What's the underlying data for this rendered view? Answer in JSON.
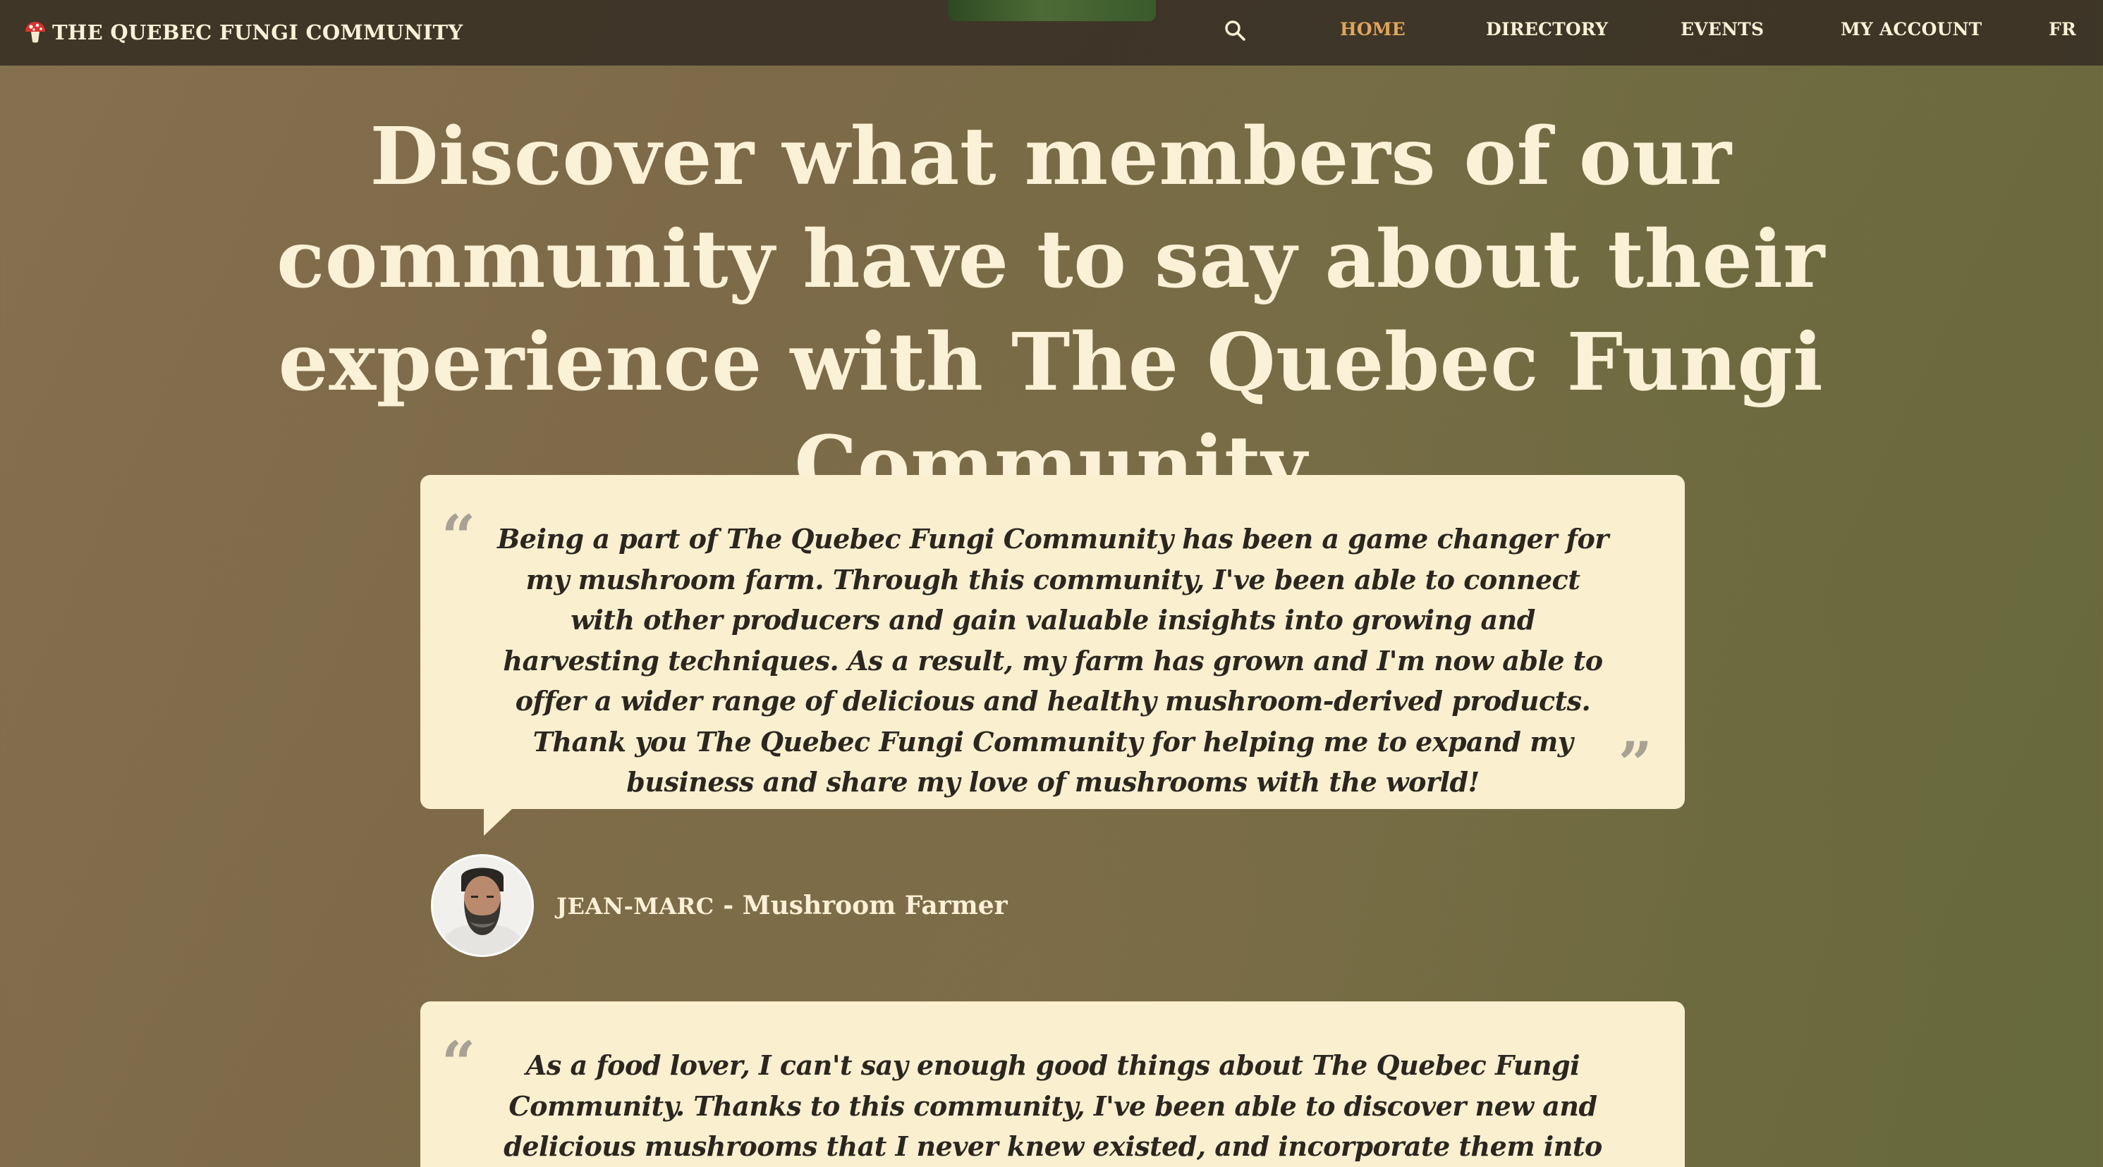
{
  "navbar": {
    "brand_label": "THE QUEBEC FUNGI COMMUNITY",
    "brand_icon": "mushroom-icon",
    "search_icon": "search-icon",
    "links": [
      {
        "label": "HOME",
        "active": true
      },
      {
        "label": "DIRECTORY",
        "active": false
      },
      {
        "label": "EVENTS",
        "active": false
      },
      {
        "label": "MY ACCOUNT",
        "active": false
      },
      {
        "label": "FR",
        "active": false
      }
    ]
  },
  "page": {
    "headline": "Discover what members of our community have to say about their experience with The Quebec Fungi Community"
  },
  "testimonials": [
    {
      "quote": "Being a part of The Quebec Fungi Community has been a game changer for my mushroom farm. Through this community, I've been able to connect with other producers and gain valuable insights into growing and harvesting techniques. As a result, my farm has grown and I'm now able to offer a wider range of delicious and healthy mushroom-derived products. Thank you The Quebec Fungi Community for helping me to expand my business and share my love of mushrooms with the world!",
      "author_name": "JEAN-MARC",
      "separator": " - ",
      "author_role": "Mushroom Farmer"
    },
    {
      "quote": "As a food lover, I can't say enough good things about The Quebec Fungi Community. Thanks to this community, I've been able to discover new and delicious mushrooms that I never knew existed, and incorporate them into my cooking in exciting new ways. Plus, it's great to"
    }
  ],
  "colors": {
    "nav_bg": "#3a3226",
    "nav_text": "#faf1d6",
    "nav_active": "#e0a55a",
    "card_bg": "#faefcf",
    "quote_text": "#2a2620",
    "quote_marks": "#a8a294",
    "headline": "#faf1d6"
  }
}
